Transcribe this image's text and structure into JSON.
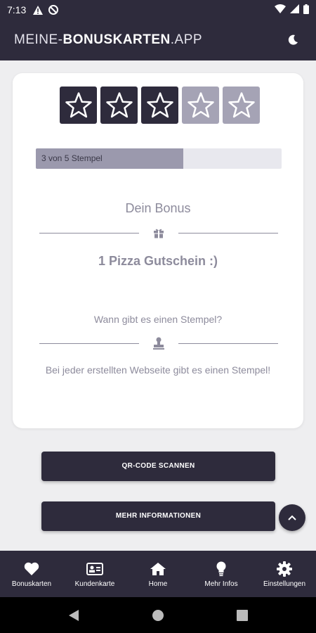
{
  "status_bar": {
    "time": "7:13",
    "icons": [
      "warning-icon",
      "blocked-icon",
      "wifi-icon",
      "signal-icon",
      "battery-icon"
    ]
  },
  "header": {
    "brand_prefix": "MEINE-",
    "brand_bold": "BONUSKARTEN",
    "brand_suffix": ".APP",
    "theme_toggle_icon": "moon-icon"
  },
  "card": {
    "stamps": {
      "filled": 3,
      "total": 5
    },
    "progress": {
      "label": "3 von 5 Stempel",
      "fraction": 0.6
    },
    "bonus_title": "Dein Bonus",
    "bonus_value": "1 Pizza Gutschein :)",
    "question": "Wann gibt es einen Stempel?",
    "answer": "Bei jeder erstellten Webseite gibt es einen Stempel!"
  },
  "buttons": {
    "scan": "QR-CODE SCANNEN",
    "info": "MEHR INFORMATIONEN"
  },
  "bottom_nav": {
    "items": [
      {
        "label": "Bonuskarten",
        "icon": "heart-icon"
      },
      {
        "label": "Kundenkarte",
        "icon": "id-card-icon"
      },
      {
        "label": "Home",
        "icon": "home-icon"
      },
      {
        "label": "Mehr Infos",
        "icon": "lightbulb-icon"
      },
      {
        "label": "Einstellungen",
        "icon": "gear-icon"
      }
    ]
  },
  "colors": {
    "primary": "#2e2b3c",
    "muted": "#8d8b9c",
    "star_empty": "#a5a3b5",
    "progress_fill": "#9b99ad"
  }
}
